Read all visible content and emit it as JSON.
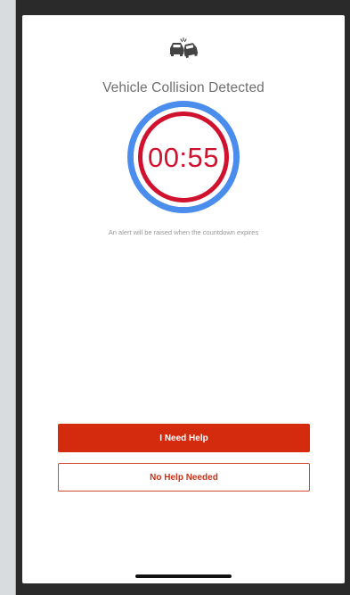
{
  "header": {
    "icon": "car-collision-icon"
  },
  "alert": {
    "title": "Vehicle Collision Detected",
    "countdown": "00:55",
    "message": "An alert will be raised when the countdown expires"
  },
  "actions": {
    "need_help_label": "I Need Help",
    "no_help_label": "No Help Needed"
  },
  "colors": {
    "outer_ring": "#4a8ded",
    "inner_ring": "#d0122e",
    "primary_button": "#d42a0e"
  }
}
